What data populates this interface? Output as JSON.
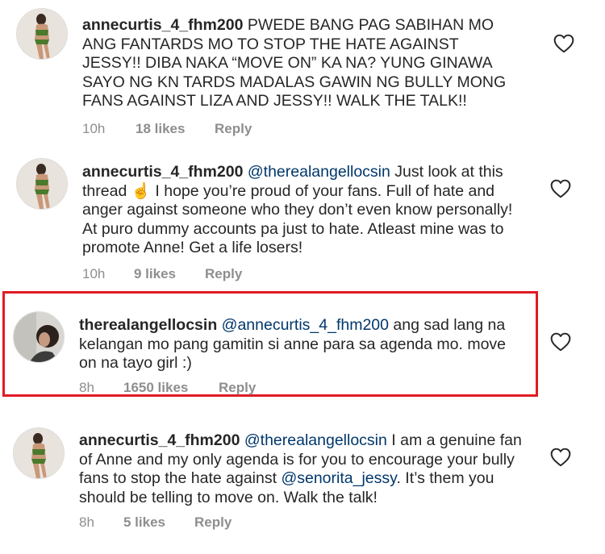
{
  "comments": [
    {
      "username": "annecurtis_4_fhm200",
      "mention": "",
      "text": " PWEDE BANG PAG SABIHAN MO ANG FANTARDS MO TO STOP THE HATE AGAINST JESSY!! DIBA NAKA “MOVE ON” KA NA? YUNG GINAWA SAYO NG KN TARDS MADALAS GAWIN NG BULLY MONG FANS AGAINST LIZA AND JESSY!! WALK THE TALK!!",
      "time": "10h",
      "likes": "18 likes",
      "reply": "Reply"
    },
    {
      "username": "annecurtis_4_fhm200",
      "mention": "@therealangellocsin",
      "text": " Just look at this thread ☝️ I hope you’re proud of your fans. Full of hate and anger against someone who they don’t even know personally! At puro dummy accounts pa just to hate. Atleast mine was to promote Anne! Get a life losers!",
      "time": "10h",
      "likes": "9 likes",
      "reply": "Reply"
    },
    {
      "username": "therealangellocsin",
      "mention": "@annecurtis_4_fhm200",
      "text": " ang sad lang na kelangan mo pang gamitin si anne para sa agenda mo. move on na tayo girl :)",
      "time": "8h",
      "likes": "1650 likes",
      "reply": "Reply"
    },
    {
      "username": "annecurtis_4_fhm200",
      "mention": "@therealangellocsin",
      "text": " I am a genuine fan of Anne and my only agenda is for you to encourage your bully fans to stop the hate against ",
      "mention2": "@senorita_jessy",
      "text2": ". It’s them you should be telling to move on. Walk the talk!",
      "time": "8h",
      "likes": "5 likes",
      "reply": "Reply"
    }
  ],
  "colors": {
    "text": "#262626",
    "meta": "#8e8e8e",
    "mention": "#00376b",
    "highlight_border": "#e01b24"
  },
  "icons": {
    "like": "heart-outline-icon"
  }
}
